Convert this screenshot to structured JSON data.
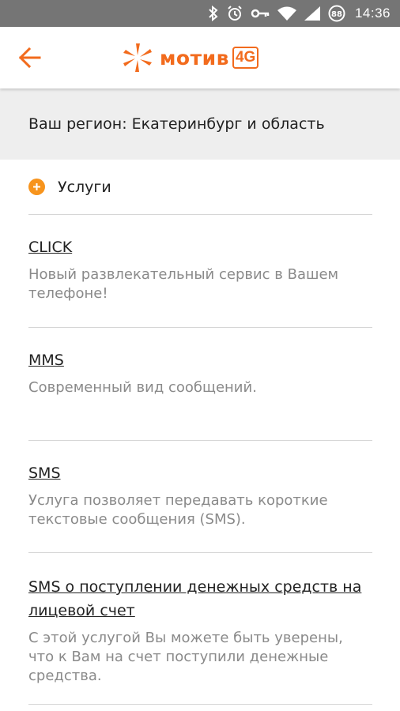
{
  "status_bar": {
    "time": "14:36",
    "icons": [
      "bluetooth-icon",
      "alarm-icon",
      "key-icon",
      "wifi-icon",
      "signal-icon",
      "battery-icon"
    ],
    "battery_level": "88"
  },
  "app_bar": {
    "back_icon": "back-arrow-icon",
    "logo_text": "мотив",
    "logo_badge": "4G",
    "accent_color": "#f26b1d"
  },
  "region": {
    "text": "Ваш регион: Екатеринбург и область"
  },
  "section": {
    "label": "Услуги",
    "icon": "plus-circle-icon"
  },
  "services": [
    {
      "title": "CLICK",
      "description": "Новый развлекательный сервис в Вашем телефоне!"
    },
    {
      "title": "MMS",
      "description": "Современный вид сообщений."
    },
    {
      "title": "SMS",
      "description": "Услуга позволяет передавать короткие текстовые сообщения (SMS)."
    },
    {
      "title": "SMS о поступлении денежных средств на лицевой счет",
      "description": "С этой услугой Вы можете быть уверены, что к Вам на счет поступили денежные средства."
    }
  ]
}
